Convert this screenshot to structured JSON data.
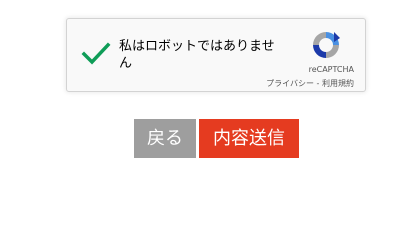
{
  "recaptcha": {
    "checkbox_label": "私はロボットではありません",
    "brand": "reCAPTCHA",
    "privacy": "プライバシー",
    "separator": " - ",
    "terms": "利用規約",
    "checked": true,
    "colors": {
      "check": "#0f9d58",
      "logo_blue": "#4a90e2",
      "logo_dark_blue": "#1c3aa9",
      "logo_gray": "#a6a6a6"
    }
  },
  "buttons": {
    "back_label": "戻る",
    "submit_label": "内容送信",
    "colors": {
      "back": "#9e9e9e",
      "submit": "#e53b20"
    }
  }
}
